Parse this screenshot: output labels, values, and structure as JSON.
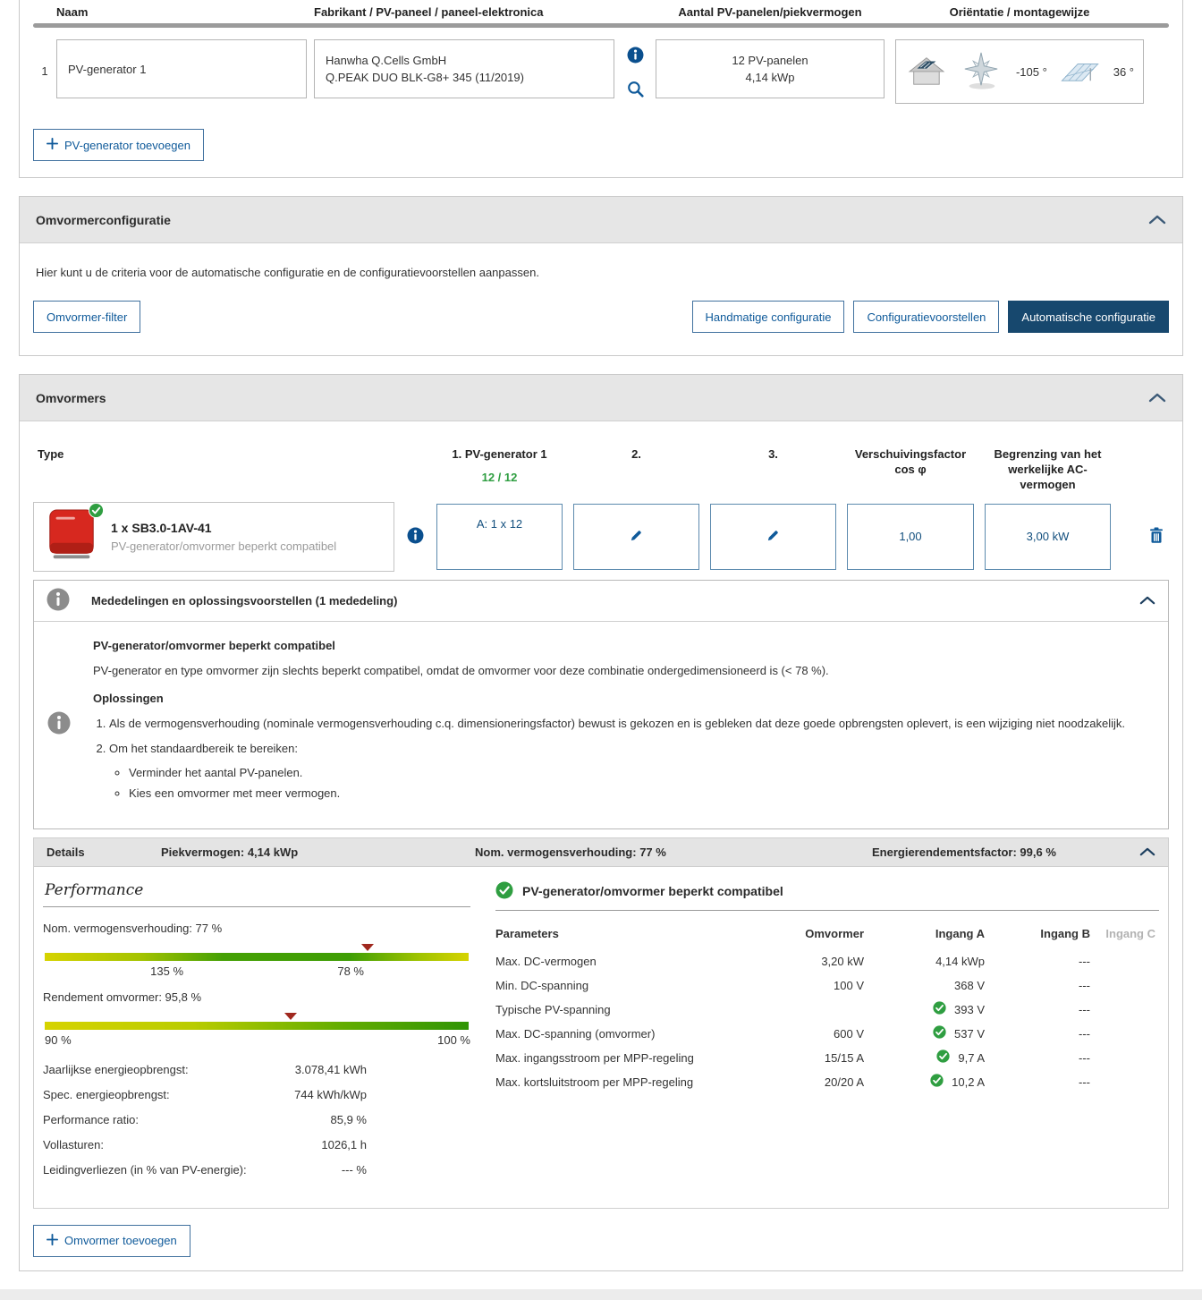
{
  "colors": {
    "accent_blue": "#0f5a9a",
    "active_button_navy": "#17486e",
    "success_green": "#2f9e41",
    "inverter_red": "#d7281f",
    "section_header_gray": "#e6e6e6",
    "marker_red": "#a0281e"
  },
  "pv_section": {
    "headers": {
      "name": "Naam",
      "manufacturer": "Fabrikant / PV-paneel / paneel-elektronica",
      "count": "Aantal PV-panelen/piekvermogen",
      "orientation": "Oriëntatie / montagewijze"
    },
    "row": {
      "index": "1",
      "name": "PV-generator 1",
      "manufacturer": "Hanwha Q.Cells GmbH",
      "panel": "Q.PEAK DUO BLK-G8+ 345 (11/2019)",
      "panel_count": "12 PV-panelen",
      "peak_power": "4,14 kWp",
      "azimuth": "-105 °",
      "tilt": "36 °"
    },
    "add_button": "PV-generator toevoegen"
  },
  "inverter_config": {
    "title": "Omvormerconfiguratie",
    "description": "Hier kunt u de criteria voor de automatische configuratie en de configuratievoorstellen aanpassen.",
    "buttons": {
      "filter": "Omvormer-filter",
      "manual": "Handmatige configuratie",
      "proposals": "Configuratievoorstellen",
      "automatic": "Automatische configuratie"
    }
  },
  "inverters": {
    "title": "Omvormers",
    "table": {
      "type_header": "Type",
      "gen1_header": "1. PV-generator 1",
      "gen1_count": "12 / 12",
      "col2_header": "2.",
      "col3_header": "3.",
      "cos_phi_header": "Verschuivingsfactor cos φ",
      "ac_limit_header": "Begrenzing van het werkelijke AC-vermogen"
    },
    "row": {
      "name": "1 x SB3.0-1AV-41",
      "status": "PV-generator/omvormer beperkt compatibel",
      "assignment_a": "A: 1 x 12",
      "cos_phi": "1,00",
      "ac_limit": "3,00 kW"
    },
    "add_button": "Omvormer toevoegen"
  },
  "messages": {
    "title": "Mededelingen en oplossingsvoorstellen (1 mededeling)",
    "heading": "PV-generator/omvormer beperkt compatibel",
    "body": "PV-generator en type omvormer zijn slechts beperkt compatibel, omdat de omvormer voor deze combinatie ondergedimensioneerd is (< 78 %).",
    "solutions_title": "Oplossingen",
    "item1": "Als de vermogensverhouding (nominale vermogensverhouding c.q. dimensioneringsfactor) bewust is gekozen en is gebleken dat deze goede opbrengsten oplevert, is een wijziging niet noodzakelijk.",
    "item2": "Om het standaardbereik te bereiken:",
    "item2a": "Verminder het aantal PV-panelen.",
    "item2b": "Kies een omvormer met meer vermogen."
  },
  "details_bar": {
    "label": "Details",
    "peak_power": "Piekvermogen: 4,14 kWp",
    "nom_ratio": "Nom. vermogensverhouding: 77 %",
    "energy_factor": "Energierendementsfactor: 99,6 %"
  },
  "performance": {
    "title": "Performance",
    "bar1_label": "Nom. vermogensverhouding: 77 %",
    "bar1_tick_left": "135 %",
    "bar1_tick_right": "78 %",
    "bar2_label": "Rendement omvormer: 95,8 %",
    "bar2_tick_left": "90 %",
    "bar2_tick_right": "100 %",
    "stats": [
      {
        "label": "Jaarlijkse energieopbrengst:",
        "value": "3.078,41 kWh"
      },
      {
        "label": "Spec. energieopbrengst:",
        "value": "744 kWh/kWp"
      },
      {
        "label": "Performance ratio:",
        "value": "85,9 %"
      },
      {
        "label": "Vollasturen:",
        "value": "1026,1 h"
      },
      {
        "label": "Leidingverliezen (in % van PV-energie):",
        "value": "--- %"
      }
    ]
  },
  "compat": {
    "title": "PV-generator/omvormer beperkt compatibel",
    "headers": {
      "params": "Parameters",
      "inverter": "Omvormer",
      "input_a": "Ingang A",
      "input_b": "Ingang B",
      "input_c": "Ingang C"
    },
    "rows": [
      {
        "label": "Max. DC-vermogen",
        "inverter": "3,20 kW",
        "a": "4,14 kWp",
        "a_check": false,
        "b": "---"
      },
      {
        "label": "Min. DC-spanning",
        "inverter": "100 V",
        "a": "368 V",
        "a_check": false,
        "b": "---"
      },
      {
        "label": "Typische PV-spanning",
        "inverter": "",
        "a": "393 V",
        "a_check": true,
        "b": "---"
      },
      {
        "label": "Max. DC-spanning (omvormer)",
        "inverter": "600 V",
        "a": "537 V",
        "a_check": true,
        "b": "---"
      },
      {
        "label": "Max. ingangsstroom per MPP-regeling",
        "inverter": "15/15 A",
        "a": "9,7 A",
        "a_check": true,
        "b": "---"
      },
      {
        "label": "Max. kortsluitstroom per MPP-regeling",
        "inverter": "20/20 A",
        "a": "10,2 A",
        "a_check": true,
        "b": "---"
      }
    ]
  }
}
